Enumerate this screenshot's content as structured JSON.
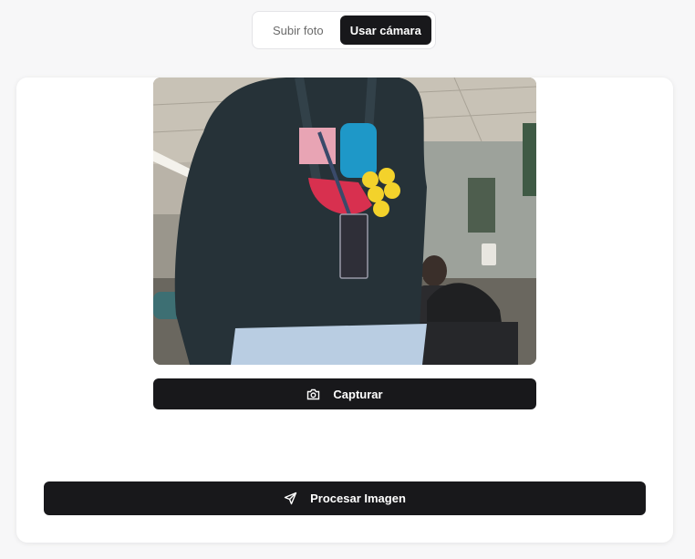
{
  "mode_toggle": {
    "upload_label": "Subir foto",
    "camera_label": "Usar cámara",
    "active": "camera"
  },
  "camera": {
    "capture_label": "Capturar",
    "capture_icon": "camera-icon"
  },
  "process": {
    "label": "Procesar Imagen",
    "icon": "send-icon"
  },
  "colors": {
    "accent": "#18181b",
    "background": "#f7f7f8",
    "card": "#ffffff",
    "muted_text": "#6b6b6b"
  }
}
